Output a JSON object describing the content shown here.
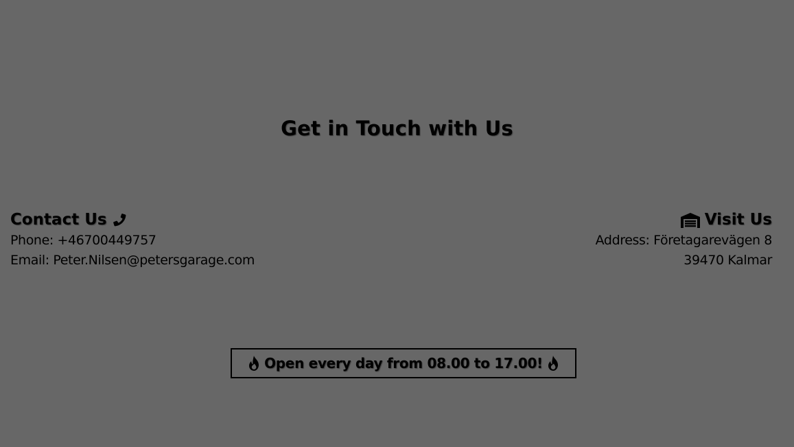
{
  "section": {
    "title": "Get in Touch with Us"
  },
  "contact": {
    "heading": "Contact Us",
    "icon": "phone-icon",
    "phone_line": "Phone: +46700449757",
    "email_line": "Email: Peter.Nilsen@petersgarage.com"
  },
  "visit": {
    "heading": "Visit Us",
    "icon": "garage-icon",
    "address_line_1": "Address: Företagarevägen 8",
    "address_line_2": "39470 Kalmar"
  },
  "hours": {
    "text": "Open every day from 08.00 to 17.00!",
    "icon": "fire-icon"
  },
  "colors": {
    "background": "#676767",
    "text": "#000000"
  }
}
